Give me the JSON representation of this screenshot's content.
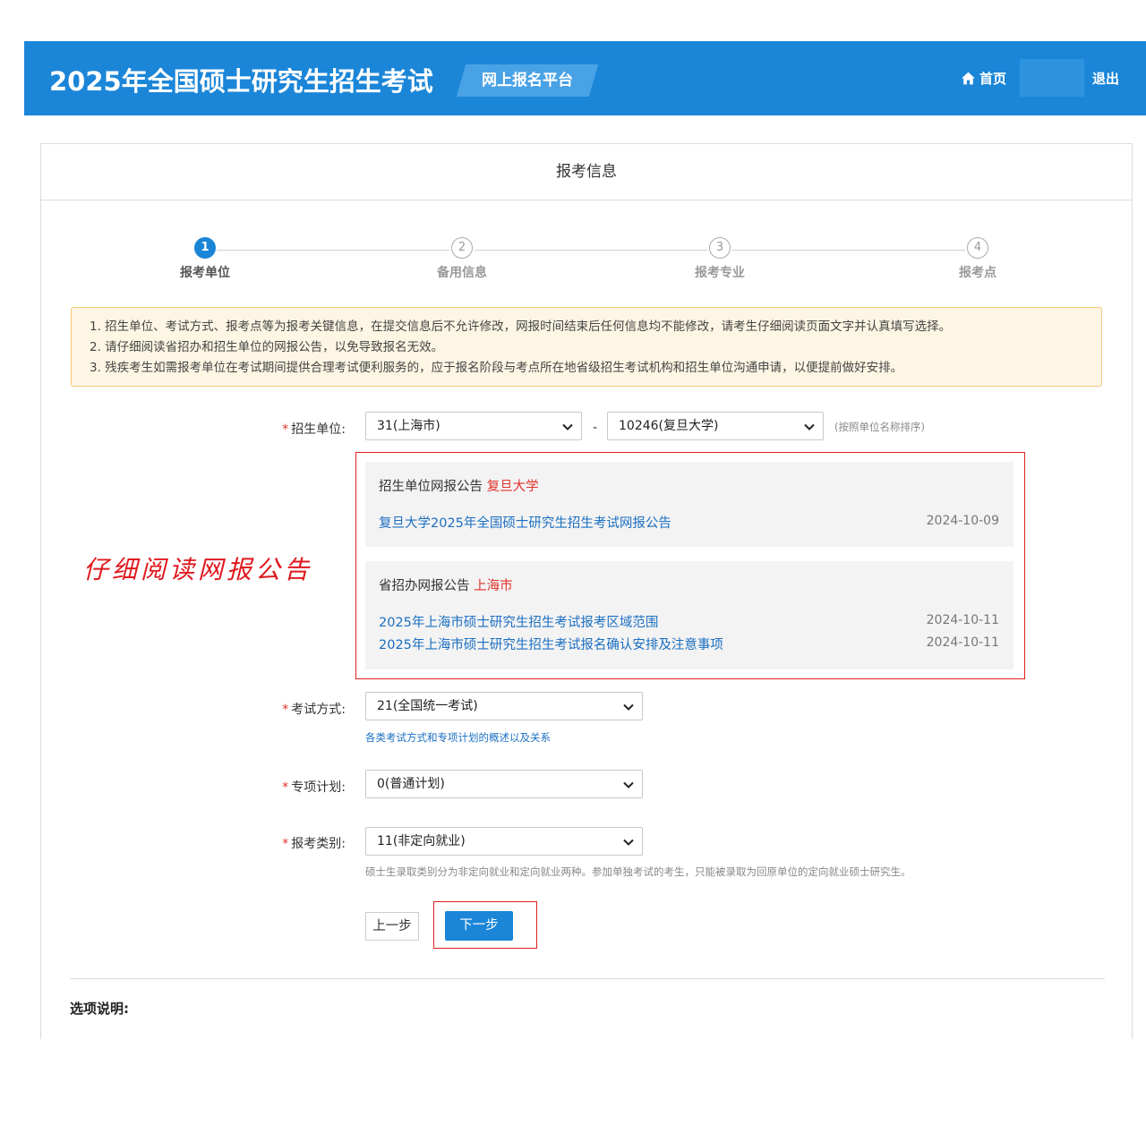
{
  "header": {
    "title": "2025年全国硕士研究生招生考试",
    "subtitle": "网上报名平台",
    "home_label": "首页",
    "logout_label": "退出"
  },
  "panel": {
    "title": "报考信息"
  },
  "steps": [
    {
      "number": "1",
      "label": "报考单位",
      "active": true
    },
    {
      "number": "2",
      "label": "备用信息",
      "active": false
    },
    {
      "number": "3",
      "label": "报考专业",
      "active": false
    },
    {
      "number": "4",
      "label": "报考点",
      "active": false
    }
  ],
  "notice": {
    "lines": [
      "1. 招生单位、考试方式、报考点等为报考关键信息，在提交信息后不允许修改，网报时间结束后任何信息均不能修改，请考生仔细阅读页面文字并认真填写选择。",
      "2. 请仔细阅读省招办和招生单位的网报公告，以免导致报名无效。",
      "3. 残疾考生如需报考单位在考试期间提供合理考试便利服务的，应于报名阶段与考点所在地省级招生考试机构和招生单位沟通申请，以便提前做好安排。"
    ]
  },
  "form": {
    "unit": {
      "label": "招生单位:",
      "province_value": "31(上海市)",
      "school_value": "10246(复旦大学)",
      "separator": "-",
      "sort_hint": "(按照单位名称排序)"
    },
    "exam_mode": {
      "label": "考试方式:",
      "value": "21(全国统一考试)",
      "help_link": "各类考试方式和专项计划的概述以及关系"
    },
    "special_plan": {
      "label": "专项计划:",
      "value": "0(普通计划)"
    },
    "category": {
      "label": "报考类别:",
      "value": "11(非定向就业)",
      "hint": "硕士生录取类别分为非定向就业和定向就业两种。参加单独考试的考生，只能被录取为回原单位的定向就业硕士研究生。"
    }
  },
  "announcements": {
    "school": {
      "title": "招生单位网报公告",
      "title_highlight": "复旦大学",
      "items": [
        {
          "text": "复旦大学2025年全国硕士研究生招生考试网报公告",
          "date": "2024-10-09"
        }
      ]
    },
    "province": {
      "title": "省招办网报公告",
      "title_highlight": "上海市",
      "items": [
        {
          "text": "2025年上海市硕士研究生招生考试报考区域范围",
          "date": "2024-10-11"
        },
        {
          "text": "2025年上海市硕士研究生招生考试报名确认安排及注意事项",
          "date": "2024-10-11"
        }
      ]
    }
  },
  "annotation": {
    "text": "仔细阅读网报公告"
  },
  "buttons": {
    "prev": "上一步",
    "next": "下一步"
  },
  "options_title": "选项说明:",
  "colors": {
    "primary": "#1b86d8",
    "required": "#e0322c",
    "annotation": "#e0181e",
    "notice_bg": "#fdf6e4",
    "notice_border": "#f3c775"
  }
}
